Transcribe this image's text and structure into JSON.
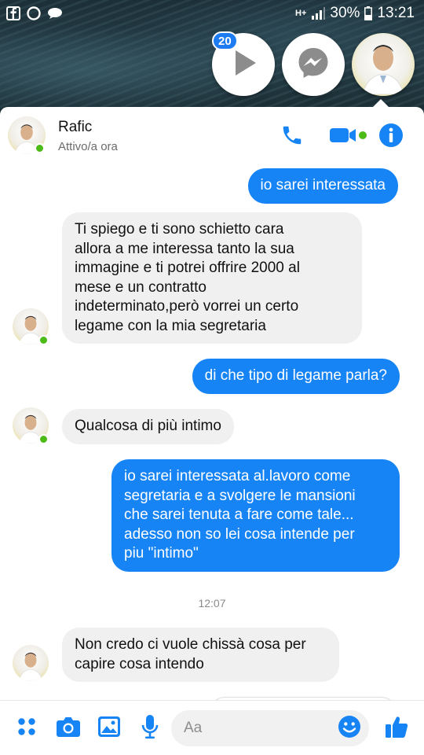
{
  "status_bar": {
    "network": "H+",
    "battery": "30%",
    "time": "13:21"
  },
  "chat_heads": {
    "badge_count": "20"
  },
  "header": {
    "contact_name": "Rafic",
    "contact_status": "Attivo/a ora"
  },
  "messages": [
    {
      "from": "me",
      "text": "io sarei interessata"
    },
    {
      "from": "them",
      "text": "Ti spiego e ti sono schietto cara\nallora a me interessa tanto la sua\nimmagine e ti potrei offrire 2000 al\nmese e un contratto\nindeterminato,però vorrei un certo\nlegame con la mia segretaria"
    },
    {
      "from": "me",
      "text": "di che tipo di legame parla?"
    },
    {
      "from": "them",
      "text": "Qualcosa di più intimo"
    },
    {
      "from": "me",
      "text": "io sarei interessata al.lavoro come\nsegretaria e a svolgere le mansioni\nche sarei tenuta a fare come tale...\nadesso non so lei cosa intende per\npiu \"intimo\""
    },
    {
      "from": "them",
      "text": "Non credo ci vuole chissà cosa per\ncapire cosa intendo"
    }
  ],
  "timestamp": "12:07",
  "composer": {
    "placeholder": "Aa"
  },
  "colors": {
    "messenger_blue": "#1784f5",
    "incoming_bubble": "#f1f0f0",
    "online_green": "#4cbb17"
  },
  "icons": [
    "facebook-icon",
    "facebook-o-icon",
    "chat-icon",
    "signal-icon",
    "battery-icon",
    "play-icon",
    "messenger-icon",
    "phone-icon",
    "video-icon",
    "info-icon",
    "apps-icon",
    "camera-icon",
    "gallery-icon",
    "mic-icon",
    "emoji-icon",
    "like-icon"
  ]
}
